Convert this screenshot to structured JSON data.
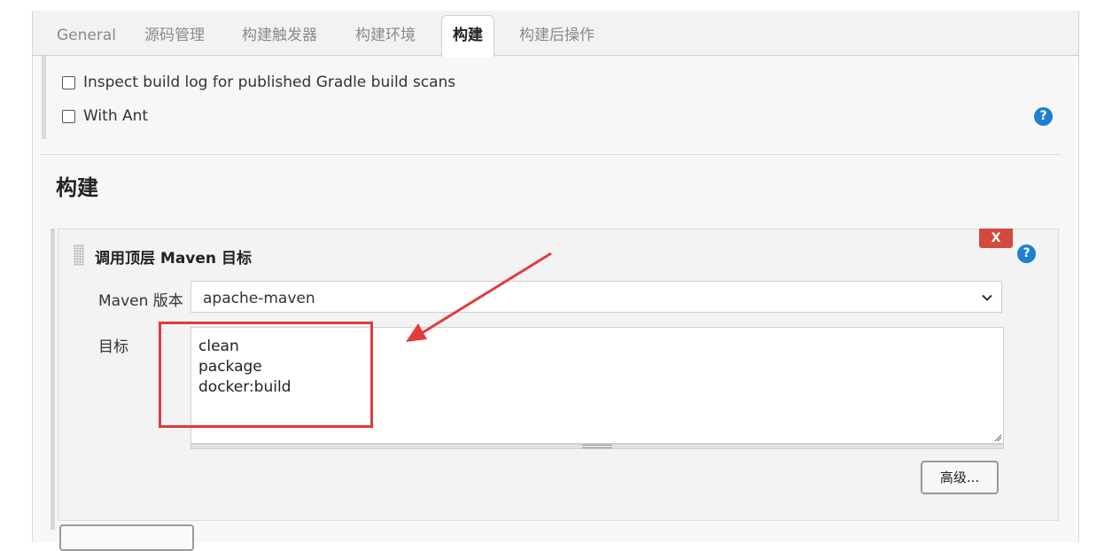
{
  "tabs": [
    {
      "label": "General"
    },
    {
      "label": "源码管理"
    },
    {
      "label": "构建触发器"
    },
    {
      "label": "构建环境"
    },
    {
      "label": "构建"
    },
    {
      "label": "构建后操作"
    }
  ],
  "prev_section": {
    "checkboxes": [
      {
        "label": "Inspect build log for published Gradle build scans",
        "checked": false
      },
      {
        "label": "With Ant",
        "checked": false
      }
    ]
  },
  "build_section": {
    "title": "构建",
    "step": {
      "title": "调用顶层 Maven 目标",
      "delete_label": "X",
      "maven_version_label": "Maven 版本",
      "maven_version_value": "apache-maven",
      "goals_label": "目标",
      "goals_value": "clean\npackage\ndocker:build",
      "advanced_label": "高级..."
    }
  },
  "help_icon_glyph": "?",
  "colors": {
    "help_icon": "#1f7fd1",
    "delete_button": "#d24a3d",
    "annotation": "#e03c3c"
  }
}
